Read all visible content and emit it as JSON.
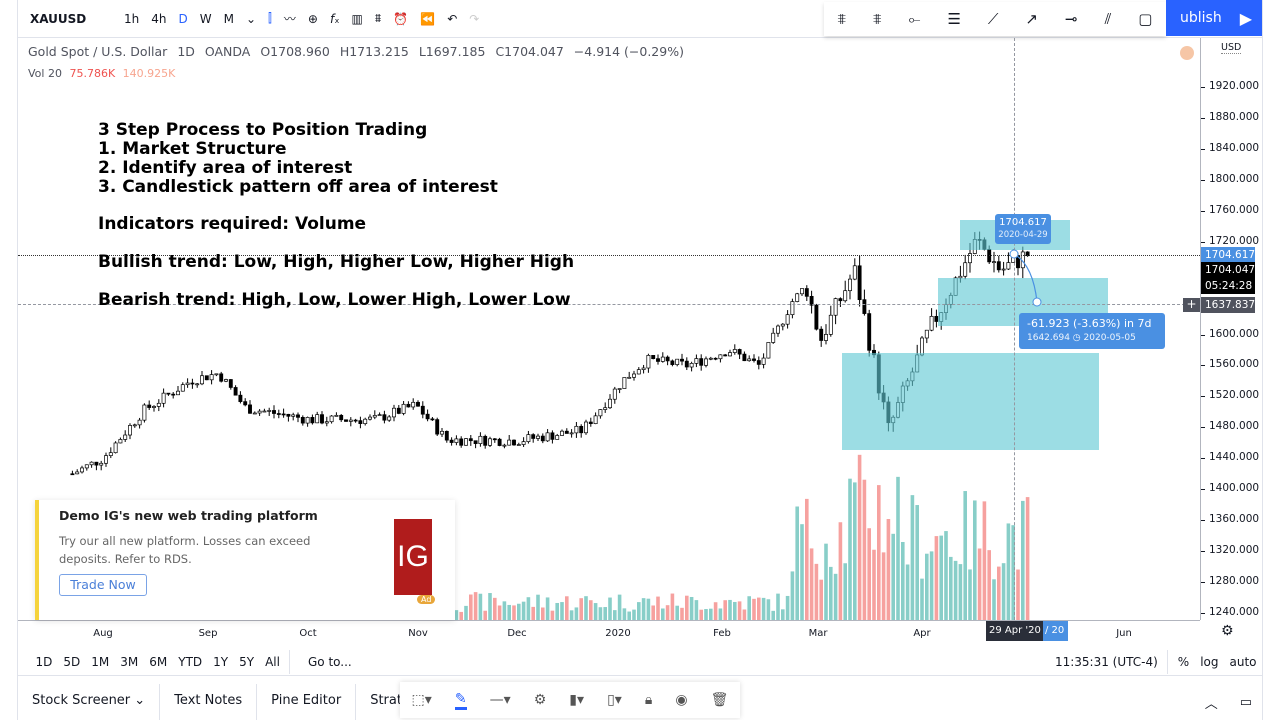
{
  "topbar": {
    "symbol": "XAUUSD",
    "intervals": [
      "1h",
      "4h",
      "D",
      "W",
      "M"
    ],
    "active_interval": "D",
    "publish_label": "ublish"
  },
  "legend": {
    "title": "Gold Spot / U.S. Dollar",
    "interval": "1D",
    "exchange": "OANDA",
    "open": "O1708.960",
    "high": "H1713.215",
    "low": "L1697.185",
    "close": "C1704.047",
    "change": "−4.914 (−0.29%)",
    "vol_label": "Vol 20",
    "vol_value": "75.786K",
    "vol_ma": "140.925K"
  },
  "notes": {
    "title": "3 Step Process to Position Trading",
    "step1": "1. Market Structure",
    "step2": "2. Identify area of interest",
    "step3": "3. Candlestick pattern off area of interest",
    "indicators": "Indicators required: Volume",
    "bullish": "Bullish trend: Low, High, Higher Low, Higher High",
    "bearish": "Bearish trend: High, Low, Lower High, Lower Low"
  },
  "price_axis": {
    "currency": "USD",
    "ticks": [
      "1920.000",
      "1880.000",
      "1840.000",
      "1800.000",
      "1760.000",
      "1720.000",
      "1600.000",
      "1560.000",
      "1520.000",
      "1480.000",
      "1440.000",
      "1400.000",
      "1360.000",
      "1320.000",
      "1280.000",
      "1240.000"
    ],
    "marker_price": "1704.617",
    "last_price": "1704.047",
    "countdown": "05:24:28",
    "crosshair_price": "1637.837"
  },
  "time_axis": {
    "labels": [
      "Aug",
      "Sep",
      "Oct",
      "Nov",
      "Dec",
      "2020",
      "Feb",
      "Mar",
      "Apr",
      "Jun"
    ],
    "crosshair_date": "29 Apr '20",
    "crosshair_suffix": "/ 20"
  },
  "measure": {
    "start_price": "1704.617",
    "start_date": "2020-04-29",
    "delta": "-61.923 (-3.63%) in 7d",
    "end": "1642.694 ◷ 2020-05-05"
  },
  "ranges": {
    "items": [
      "1D",
      "5D",
      "1M",
      "3M",
      "6M",
      "YTD",
      "1Y",
      "5Y",
      "All"
    ],
    "goto": "Go to...",
    "clock": "11:35:31 (UTC-4)",
    "percent": "%",
    "log": "log",
    "auto": "auto"
  },
  "bottom": {
    "tabs": [
      "Stock Screener",
      "Text Notes",
      "Pine Editor",
      "Strateg"
    ]
  },
  "ad": {
    "title": "Demo IG's new web trading platform",
    "body1": "Try our all new platform. Losses can exceed",
    "body2": "deposits. Refer to RDS.",
    "button": "Trade Now",
    "logo": "IG",
    "badge": "Ad"
  },
  "colors": {
    "up": "#26a69a",
    "down": "#ef5350",
    "box": "#5fc8d4",
    "accent": "#2962ff",
    "measure": "#4a90e2"
  },
  "chart_data": {
    "type": "candlestick",
    "symbol": "XAUUSD",
    "ylim": [
      1240,
      1930
    ],
    "price_path": [
      [
        "2019-07-23",
        1420
      ],
      [
        "2019-08-01",
        1440
      ],
      [
        "2019-08-13",
        1502
      ],
      [
        "2019-08-27",
        1541
      ],
      [
        "2019-09-04",
        1550
      ],
      [
        "2019-09-12",
        1505
      ],
      [
        "2019-10-01",
        1490
      ],
      [
        "2019-10-20",
        1490
      ],
      [
        "2019-11-01",
        1509
      ],
      [
        "2019-11-10",
        1464
      ],
      [
        "2019-12-01",
        1463
      ],
      [
        "2019-12-20",
        1476
      ],
      [
        "2020-01-01",
        1541
      ],
      [
        "2020-01-08",
        1567
      ],
      [
        "2020-01-20",
        1560
      ],
      [
        "2020-02-01",
        1580
      ],
      [
        "2020-02-10",
        1560
      ],
      [
        "2020-02-20",
        1645
      ],
      [
        "2020-02-24",
        1660
      ],
      [
        "2020-02-28",
        1593
      ],
      [
        "2020-03-09",
        1683
      ],
      [
        "2020-03-19",
        1476
      ],
      [
        "2020-03-31",
        1605
      ],
      [
        "2020-04-14",
        1722
      ],
      [
        "2020-04-21",
        1683
      ],
      [
        "2020-04-29",
        1704
      ]
    ]
  }
}
